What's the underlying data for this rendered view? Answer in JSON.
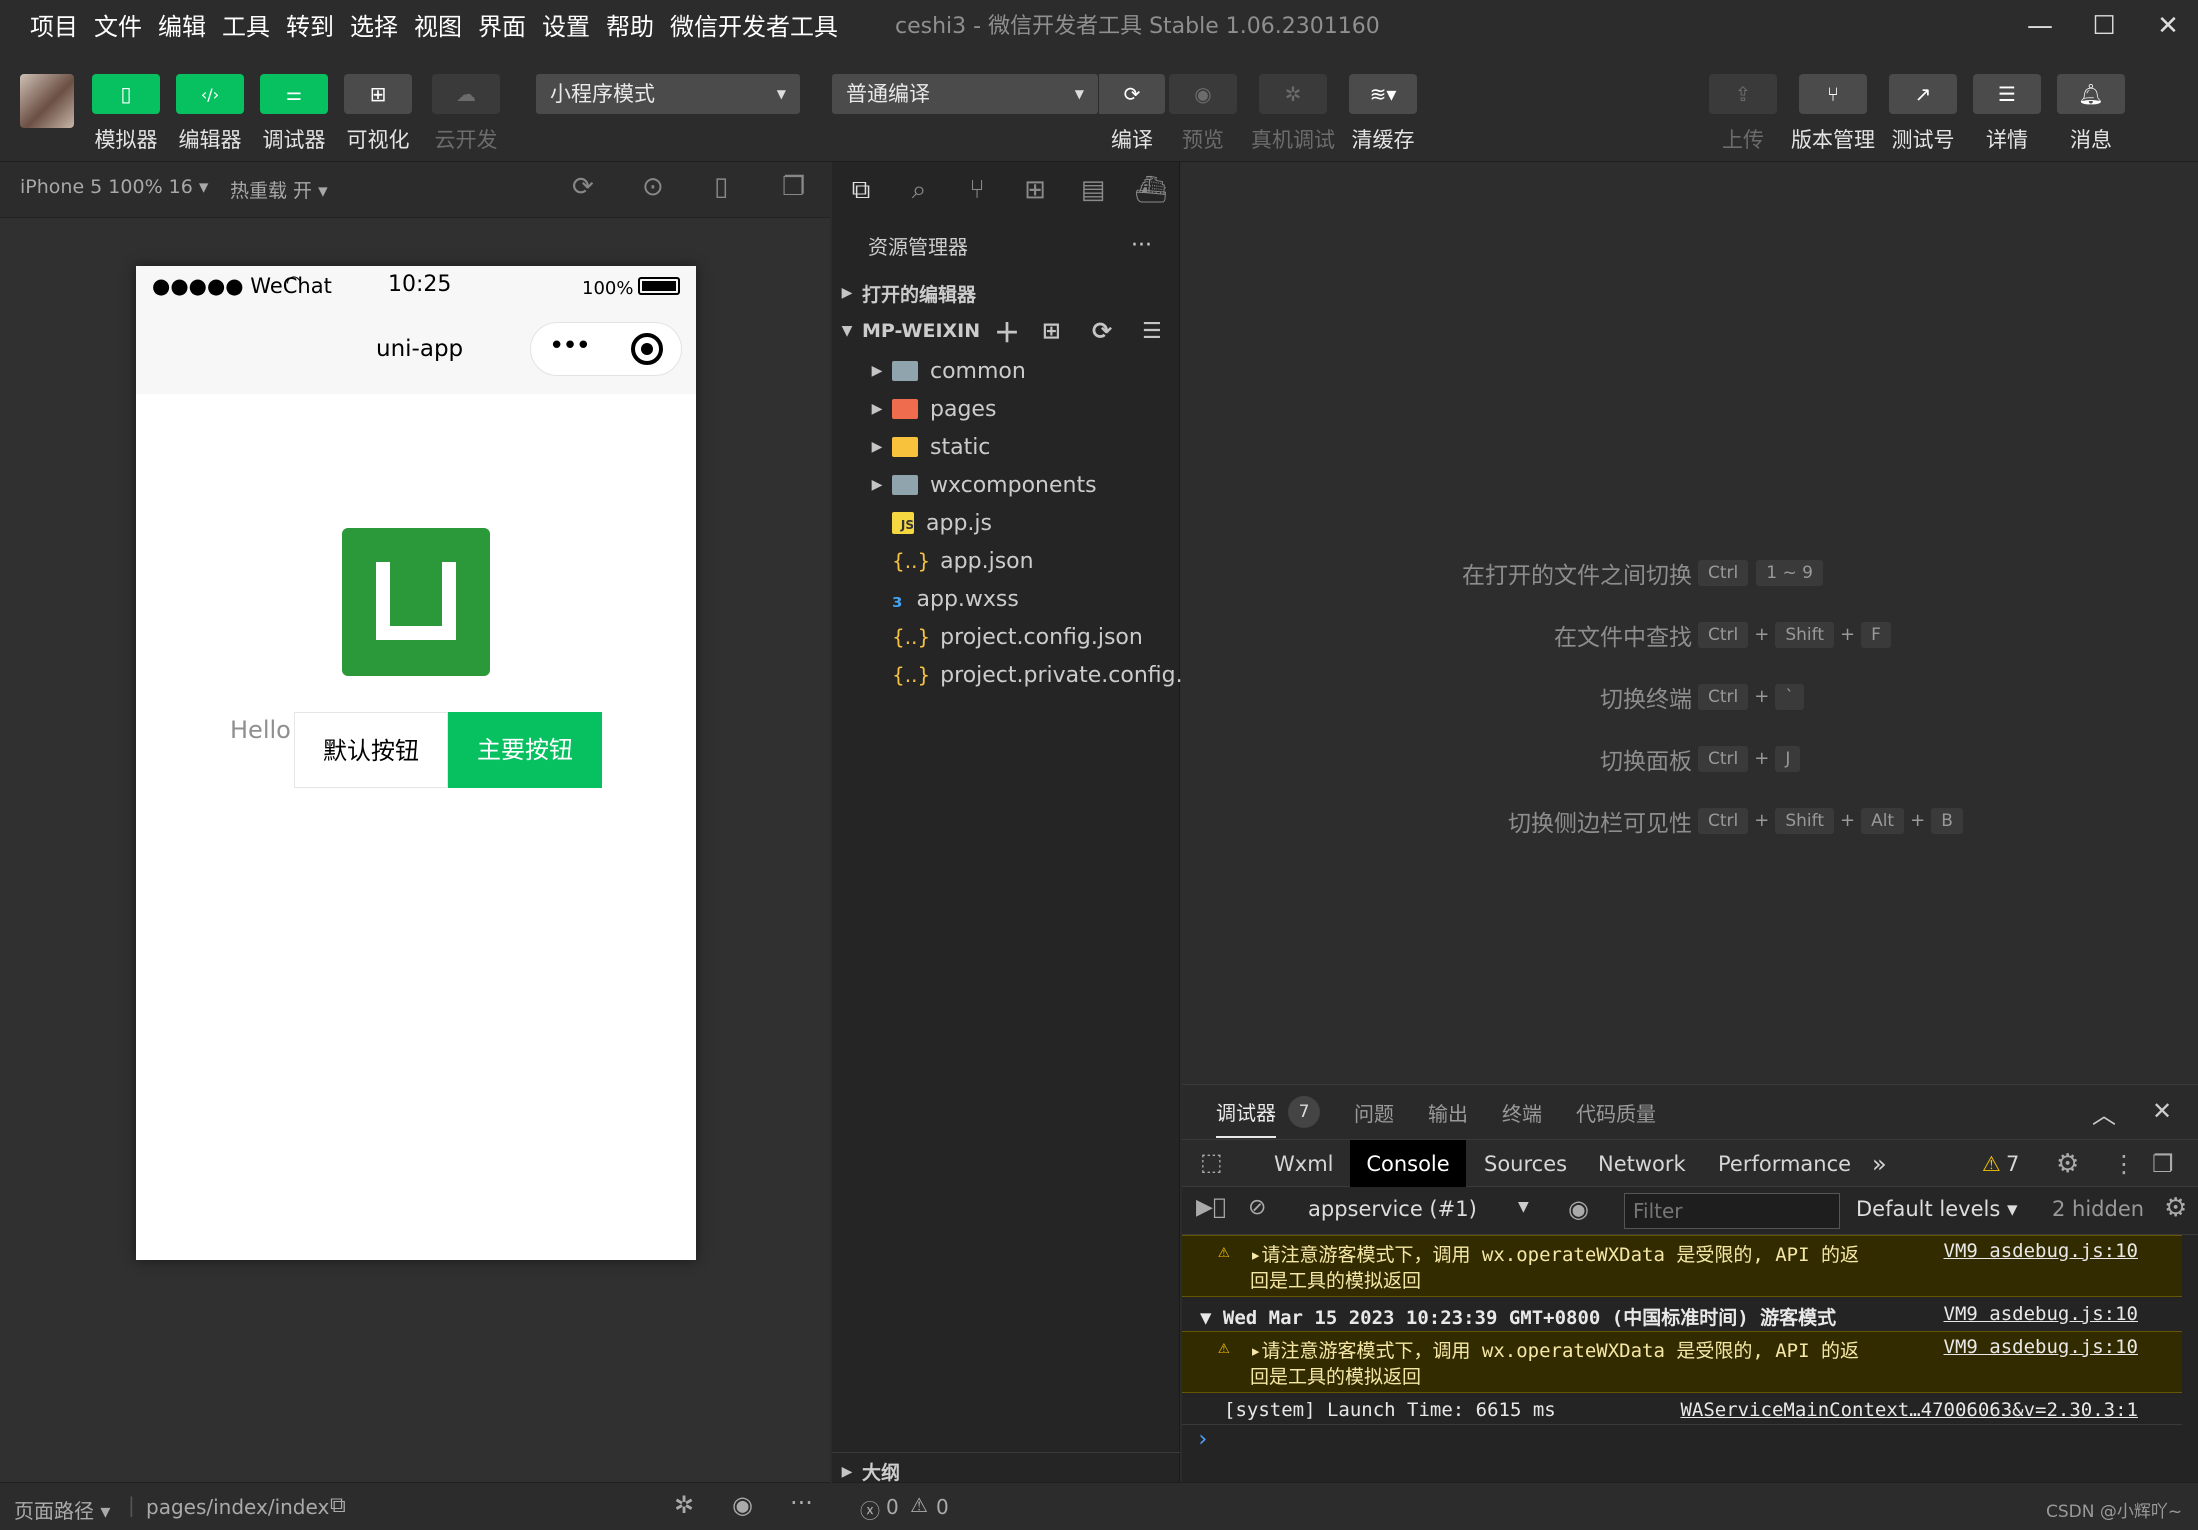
{
  "menu": [
    "项目",
    "文件",
    "编辑",
    "工具",
    "转到",
    "选择",
    "视图",
    "界面",
    "设置",
    "帮助",
    "微信开发者工具"
  ],
  "window_title": "ceshi3 - 微信开发者工具 Stable 1.06.2301160",
  "toolbar": {
    "left_buttons": [
      {
        "label": "模拟器",
        "icon": "phone-icon",
        "style": "green"
      },
      {
        "label": "编辑器",
        "icon": "code-icon",
        "style": "green"
      },
      {
        "label": "调试器",
        "icon": "debug-icon",
        "style": "green"
      },
      {
        "label": "可视化",
        "icon": "layout-icon",
        "style": "gray"
      },
      {
        "label": "云开发",
        "icon": "cloud-icon",
        "style": "dim"
      }
    ],
    "mode_select": "小程序模式",
    "compile_select": "普通编译",
    "mid_buttons": [
      {
        "label": "编译",
        "icon": "refresh-icon"
      },
      {
        "label": "预览",
        "icon": "eye-icon"
      },
      {
        "label": "真机调试",
        "icon": "bug-icon"
      },
      {
        "label": "清缓存",
        "icon": "layers-icon"
      }
    ],
    "right_buttons": [
      {
        "label": "上传",
        "icon": "upload-icon"
      },
      {
        "label": "版本管理",
        "icon": "branch-icon"
      },
      {
        "label": "测试号",
        "icon": "external-icon"
      },
      {
        "label": "详情",
        "icon": "menu-icon"
      },
      {
        "label": "消息",
        "icon": "bell-icon"
      }
    ]
  },
  "simulator": {
    "device": "iPhone 5 100% 16 ▾",
    "hot_reload": "热重载 开 ▾",
    "status_left": "●●●●● WeChat",
    "status_time": "10:25",
    "status_battery": "100%",
    "nav_title": "uni-app",
    "hello_text": "Hello",
    "default_button": "默认按钮",
    "primary_button": "主要按钮"
  },
  "explorer": {
    "title": "资源管理器",
    "open_editors": "打开的编辑器",
    "root": "MP-WEIXIN",
    "items": [
      {
        "name": "common",
        "type": "folder",
        "color": "#90a4ae"
      },
      {
        "name": "pages",
        "type": "folder",
        "color": "#ef6c4f"
      },
      {
        "name": "static",
        "type": "folder",
        "color": "#f9c23c"
      },
      {
        "name": "wxcomponents",
        "type": "folder",
        "color": "#90a4ae"
      },
      {
        "name": "app.js",
        "type": "js"
      },
      {
        "name": "app.json",
        "type": "json"
      },
      {
        "name": "app.wxss",
        "type": "css"
      },
      {
        "name": "project.config.json",
        "type": "json"
      },
      {
        "name": "project.private.config.js...",
        "type": "json"
      }
    ],
    "outline": "大纲"
  },
  "shortcuts": [
    {
      "label": "在打开的文件之间切换",
      "keys": [
        "Ctrl",
        "1 ~ 9"
      ],
      "joined": false
    },
    {
      "label": "在文件中查找",
      "keys": [
        "Ctrl",
        "Shift",
        "F"
      ],
      "joined": true
    },
    {
      "label": "切换终端",
      "keys": [
        "Ctrl",
        "`"
      ],
      "joined": true
    },
    {
      "label": "切换面板",
      "keys": [
        "Ctrl",
        "J"
      ],
      "joined": true
    },
    {
      "label": "切换侧边栏可见性",
      "keys": [
        "Ctrl",
        "Shift",
        "Alt",
        "B"
      ],
      "joined": true
    }
  ],
  "debugger": {
    "tabs": [
      "调试器",
      "问题",
      "输出",
      "终端",
      "代码质量"
    ],
    "badge": "7",
    "devtools_tabs": [
      "Wxml",
      "Console",
      "Sources",
      "Network",
      "Performance"
    ],
    "more": "»",
    "warn_count": "7",
    "context": "appservice (#1)",
    "filter_placeholder": "Filter",
    "levels": "Default levels ▾",
    "hidden": "2 hidden",
    "console": [
      {
        "kind": "warn",
        "line1": "▸请注意游客模式下，调用 wx.operateWXData 是受限的, API 的返",
        "line2": "回是工具的模拟返回",
        "src": "VM9 asdebug.js:10"
      },
      {
        "kind": "group",
        "line1": "▼ Wed Mar 15 2023 10:23:39 GMT+0800 (中国标准时间) 游客模式",
        "src": "VM9 asdebug.js:10"
      },
      {
        "kind": "warn",
        "line1": "▸请注意游客模式下，调用 wx.operateWXData 是受限的, API 的返",
        "line2": "回是工具的模拟返回",
        "src": "VM9 asdebug.js:10"
      },
      {
        "kind": "log",
        "line1": "[system] Launch Time: 6615 ms",
        "src": "WAServiceMainContext…47006063&v=2.30.3:1"
      }
    ],
    "prompt": "›"
  },
  "bottom": {
    "page_path_label": "页面路径 ▾",
    "page_path": "pages/index/index",
    "errors": "0",
    "warnings": "0",
    "watermark": "CSDN @小辉吖~"
  },
  "colors": {
    "accent": "#07c160",
    "uni_green": "#2b9939"
  }
}
